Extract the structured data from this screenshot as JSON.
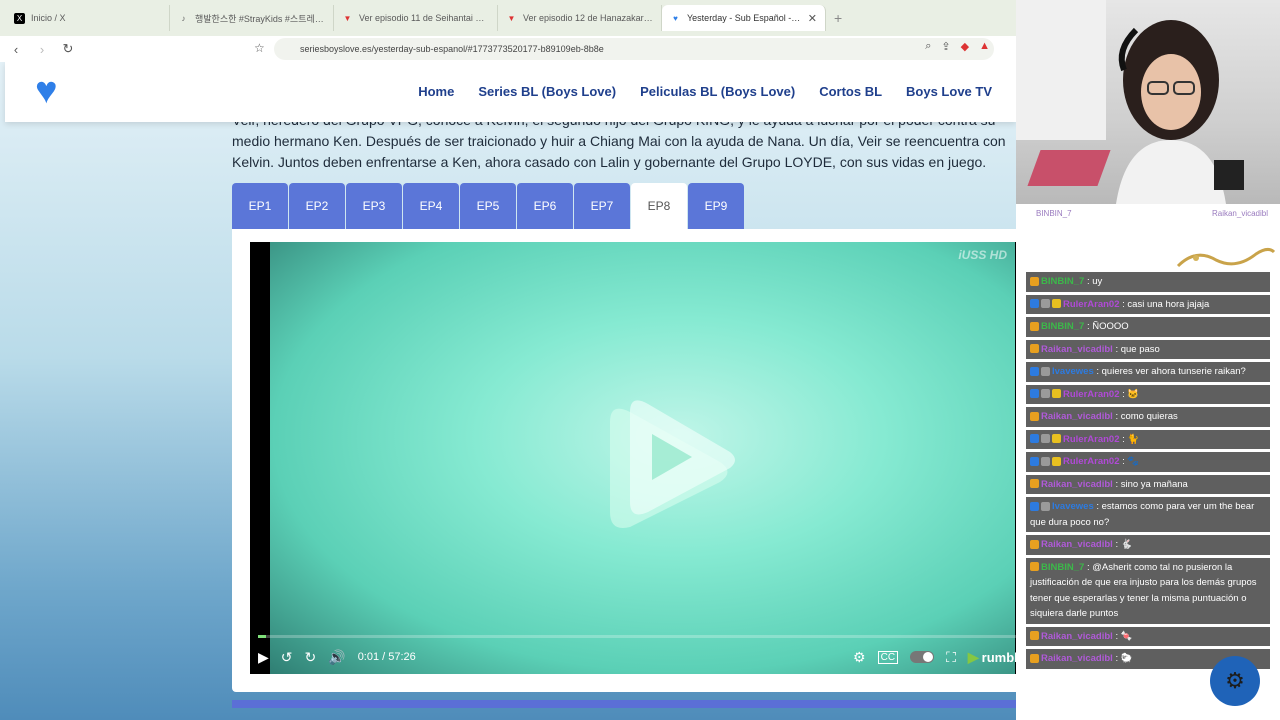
{
  "browser": {
    "tabs": [
      {
        "icon": "X",
        "label": "Inicio / X"
      },
      {
        "icon": "♪",
        "label": "행발한스한 #StrayKids #스트레이키즈"
      },
      {
        "icon": "▼",
        "label": "Ver episodio 11 de Seihantai na Kimi"
      },
      {
        "icon": "▼",
        "label": "Ver episodio 12 de Hanazakari no Kimi"
      },
      {
        "icon": "♥",
        "label": "Yesterday - Sub Español - Series"
      }
    ],
    "url": "seriesboyslove.es/yesterday-sub-espanol/#1773773520177-b89109eb-8b8e"
  },
  "site": {
    "nav": [
      "Home",
      "Series BL (Boys Love)",
      "Peliculas BL (Boys Love)",
      "Cortos BL",
      "Boys Love TV"
    ],
    "description": "Veir, heredero del Grupo VPG, conoce a Kelvin, el segundo hijo del Grupo KING, y le ayuda a luchar por el poder contra su medio hermano Ken. Después de ser traicionado y huir a Chiang Mai con la ayuda de Nana. Un día, Veir se reencuentra con Kelvin. Juntos deben enfrentarse a Ken, ahora casado con Lalin y gobernante del Grupo LOYDE, con sus vidas en juego.",
    "episodes": [
      "EP1",
      "EP2",
      "EP3",
      "EP4",
      "EP5",
      "EP6",
      "EP7",
      "EP8",
      "EP9"
    ],
    "active_episode": "EP8",
    "player": {
      "watermark": "iUSS HD",
      "time": "0:01 / 57:26",
      "progress": 0.01,
      "brand": "rumble"
    }
  },
  "overlay": {
    "cam_label_left": "BINBIN_7",
    "cam_label_right": "Raikan_vicadibl",
    "chat": [
      {
        "user": "BINBIN_7",
        "cls": "u-bin",
        "text": ": uy"
      },
      {
        "user": "RulerAran02",
        "cls": "u-ruler",
        "text": ": casi una hora jajaja"
      },
      {
        "user": "BINBIN_7",
        "cls": "u-bin",
        "text": ": ÑOOOO"
      },
      {
        "user": "Raikan_vicadibl",
        "cls": "u-raikan",
        "text": ": que paso"
      },
      {
        "user": "Ivavewes",
        "cls": "u-iva",
        "text": ": quieres ver ahora tunserie raikan?"
      },
      {
        "user": "RulerAran02",
        "cls": "u-ruler",
        "text": ": 🐱"
      },
      {
        "user": "Raikan_vicadibl",
        "cls": "u-raikan",
        "text": ": como quieras"
      },
      {
        "user": "RulerAran02",
        "cls": "u-ruler",
        "text": ": 🐈"
      },
      {
        "user": "RulerAran02",
        "cls": "u-ruler",
        "text": ": 🐾"
      },
      {
        "user": "Raikan_vicadibl",
        "cls": "u-raikan",
        "text": ": sino ya mañana"
      },
      {
        "user": "Ivavewes",
        "cls": "u-iva",
        "text": ": estamos como para ver um the bear que dura poco no?"
      },
      {
        "user": "Raikan_vicadibl",
        "cls": "u-raikan",
        "text": ": 🐇"
      },
      {
        "user": "BINBIN_7",
        "cls": "u-bin",
        "text": ": @Asherit como tal no pusieron la justificación de que era injusto para los demás grupos tener que esperarlas y tener la misma puntuación o siquiera darle puntos"
      },
      {
        "user": "Raikan_vicadibl",
        "cls": "u-raikan",
        "text": ": 🍬"
      },
      {
        "user": "Raikan_vicadibl",
        "cls": "u-raikan",
        "text": ": 🐑"
      }
    ]
  }
}
